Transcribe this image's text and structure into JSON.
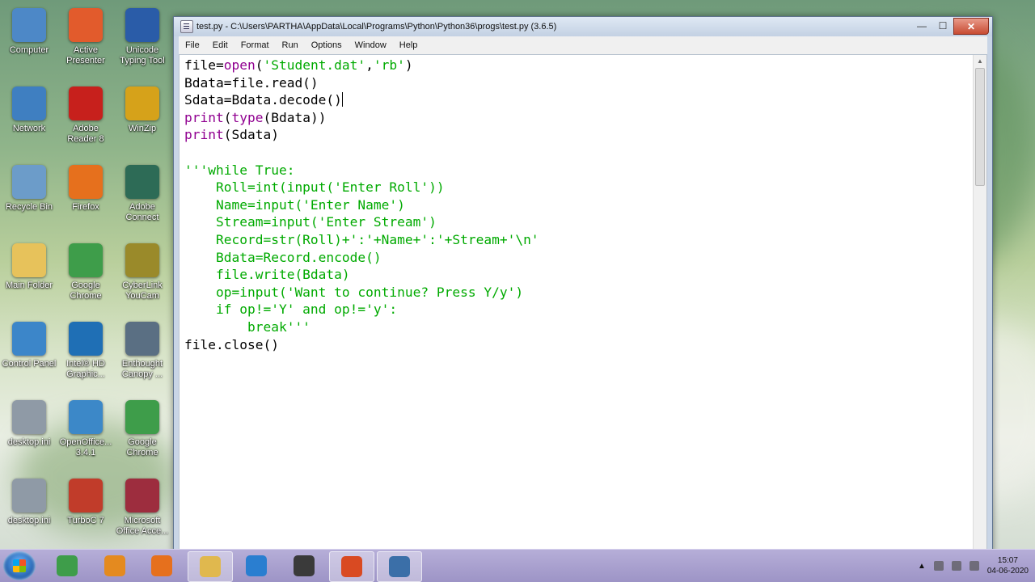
{
  "desktop": {
    "icons": [
      {
        "label": "Computer",
        "icon": "computer-icon",
        "color": "#4d88c7"
      },
      {
        "label": "Active Presenter",
        "icon": "active-presenter-icon",
        "color": "#e25b2c"
      },
      {
        "label": "Unicode Typing Tool",
        "icon": "unicode-tool-icon",
        "color": "#2a5ca8"
      },
      {
        "label": "Network",
        "icon": "network-icon",
        "color": "#3f7fc1"
      },
      {
        "label": "Adobe Reader 8",
        "icon": "adobe-reader-icon",
        "color": "#c7201c"
      },
      {
        "label": "WinZip",
        "icon": "winzip-icon",
        "color": "#d6a21a"
      },
      {
        "label": "Recycle Bin",
        "icon": "recycle-bin-icon",
        "color": "#6c9cc9"
      },
      {
        "label": "Firefox",
        "icon": "firefox-icon",
        "color": "#e6701d"
      },
      {
        "label": "Adobe Connect",
        "icon": "adobe-connect-icon",
        "color": "#2d6b56"
      },
      {
        "label": "Main Folder",
        "icon": "folder-icon",
        "color": "#e7c25b"
      },
      {
        "label": "Google Chrome",
        "icon": "chrome-icon",
        "color": "#3e9d4a"
      },
      {
        "label": "CyberLink YouCam",
        "icon": "youcam-icon",
        "color": "#9a8a2a"
      },
      {
        "label": "Control Panel",
        "icon": "control-panel-icon",
        "color": "#3c86c9"
      },
      {
        "label": "Intel® HD Graphic...",
        "icon": "intel-graphics-icon",
        "color": "#1f6fb5"
      },
      {
        "label": "Enthought Canopy ...",
        "icon": "canopy-icon",
        "color": "#5a6f83"
      },
      {
        "label": "desktop.ini",
        "icon": "ini-file-icon",
        "color": "#8f9aa6"
      },
      {
        "label": "OpenOffice... 3.4.1",
        "icon": "openoffice-icon",
        "color": "#3c88c8"
      },
      {
        "label": "Google Chrome",
        "icon": "chrome-icon",
        "color": "#3e9d4a"
      },
      {
        "label": "desktop.ini",
        "icon": "ini-file-icon",
        "color": "#8f9aa6"
      },
      {
        "label": "TurboC 7",
        "icon": "turboc-icon",
        "color": "#c13c2a"
      },
      {
        "label": "Microsoft Office Acce...",
        "icon": "ms-access-icon",
        "color": "#9d2d3e"
      }
    ]
  },
  "window": {
    "title": "test.py - C:\\Users\\PARTHA\\AppData\\Local\\Programs\\Python\\Python36\\progs\\test.py (3.6.5)",
    "min_glyph": "—",
    "max_glyph": "☐",
    "close_glyph": "✕",
    "menu": [
      "File",
      "Edit",
      "Format",
      "Run",
      "Options",
      "Window",
      "Help"
    ]
  },
  "code_lines": [
    [
      {
        "t": "file=",
        "c": ""
      },
      {
        "t": "open",
        "c": "bi"
      },
      {
        "t": "(",
        "c": ""
      },
      {
        "t": "'Student.dat'",
        "c": "st"
      },
      {
        "t": ",",
        "c": ""
      },
      {
        "t": "'rb'",
        "c": "st"
      },
      {
        "t": ")",
        "c": ""
      }
    ],
    [
      {
        "t": "Bdata=file.read()",
        "c": ""
      }
    ],
    [
      {
        "t": "Sdata=Bdata.decode()",
        "c": ""
      },
      {
        "t": "",
        "c": "caret"
      }
    ],
    [
      {
        "t": "print",
        "c": "bi"
      },
      {
        "t": "(",
        "c": ""
      },
      {
        "t": "type",
        "c": "bi"
      },
      {
        "t": "(Bdata))",
        "c": ""
      }
    ],
    [
      {
        "t": "print",
        "c": "bi"
      },
      {
        "t": "(Sdata)",
        "c": ""
      }
    ],
    [
      {
        "t": "",
        "c": ""
      }
    ],
    [
      {
        "t": "'''while True:",
        "c": "st"
      }
    ],
    [
      {
        "t": "    Roll=int(input('Enter Roll'))",
        "c": "st"
      }
    ],
    [
      {
        "t": "    Name=input('Enter Name')",
        "c": "st"
      }
    ],
    [
      {
        "t": "    Stream=input('Enter Stream')",
        "c": "st"
      }
    ],
    [
      {
        "t": "    Record=str(Roll)+':'+Name+':'+Stream+'\\n'",
        "c": "st"
      }
    ],
    [
      {
        "t": "    Bdata=Record.encode()",
        "c": "st"
      }
    ],
    [
      {
        "t": "    file.write(Bdata)",
        "c": "st"
      }
    ],
    [
      {
        "t": "    op=input('Want to continue? Press Y/y')",
        "c": "st"
      }
    ],
    [
      {
        "t": "    if op!='Y' and op!='y':",
        "c": "st"
      }
    ],
    [
      {
        "t": "        break'''",
        "c": "st"
      }
    ],
    [
      {
        "t": "file.close()",
        "c": ""
      }
    ]
  ],
  "taskbar": {
    "buttons": [
      {
        "name": "chrome-taskbar-button",
        "icon": "chrome-icon",
        "color": "#3e9d4a",
        "active": false
      },
      {
        "name": "media-player-taskbar-button",
        "icon": "media-player-icon",
        "color": "#e48a1f",
        "active": false
      },
      {
        "name": "firefox-taskbar-button",
        "icon": "firefox-icon",
        "color": "#e6701d",
        "active": false
      },
      {
        "name": "explorer-taskbar-button",
        "icon": "folder-icon",
        "color": "#e0b84e",
        "active": true
      },
      {
        "name": "ie-taskbar-button",
        "icon": "internet-explorer-icon",
        "color": "#2a7ed0",
        "active": false
      },
      {
        "name": "media-classic-taskbar-button",
        "icon": "media-classic-icon",
        "color": "#3a3a3a",
        "active": false
      },
      {
        "name": "presenter-taskbar-button",
        "icon": "active-presenter-icon",
        "color": "#d94a22",
        "active": true
      },
      {
        "name": "python-taskbar-button",
        "icon": "python-icon",
        "color": "#3b6fa8",
        "active": true
      }
    ],
    "time": "15:07",
    "date": "04-06-2020"
  }
}
